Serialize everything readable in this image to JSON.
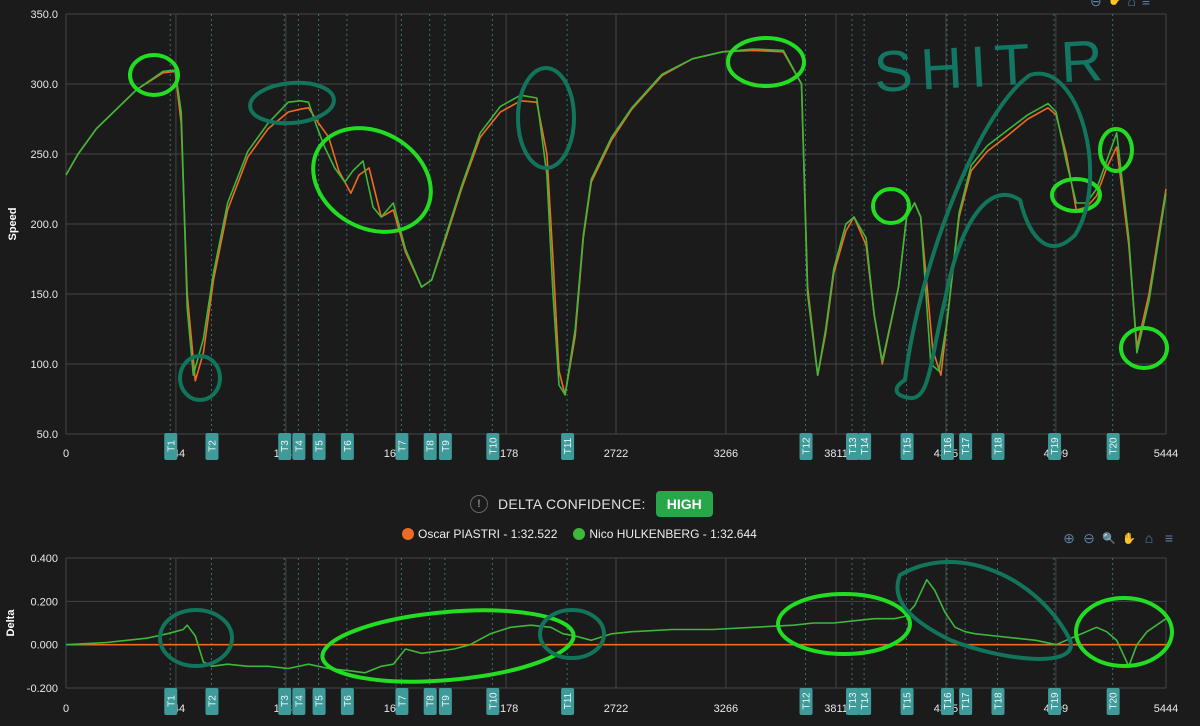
{
  "chart_data": [
    {
      "type": "line",
      "ylabel": "Speed",
      "ylim": [
        50,
        350
      ],
      "yticks": [
        "350.0",
        "300.0",
        "250.0",
        "200.0",
        "150.0",
        "100.0",
        "50.0"
      ],
      "xlim": [
        0,
        5444
      ],
      "xticks": [
        "0",
        "544",
        "1088",
        "1633",
        "2178",
        "2722",
        "3266",
        "3811",
        "4355",
        "4899",
        "5444"
      ],
      "series": [
        {
          "name": "Oscar PIASTRI",
          "color": "#ef6a22",
          "x": [
            0,
            60,
            150,
            250,
            350,
            480,
            540,
            570,
            600,
            640,
            680,
            730,
            800,
            900,
            1000,
            1100,
            1160,
            1200,
            1250,
            1300,
            1350,
            1410,
            1450,
            1500,
            1560,
            1620,
            1680,
            1760,
            1810,
            1880,
            1960,
            2050,
            2150,
            2250,
            2330,
            2380,
            2410,
            2440,
            2470,
            2520,
            2560,
            2600,
            2700,
            2800,
            2950,
            3100,
            3250,
            3400,
            3550,
            3640,
            3670,
            3720,
            3760,
            3800,
            3860,
            3900,
            3960,
            4000,
            4040,
            4120,
            4160,
            4200,
            4230,
            4290,
            4330,
            4360,
            4420,
            4480,
            4560,
            4650,
            4760,
            4860,
            4900,
            4950,
            5000,
            5050,
            5100,
            5150,
            5200,
            5260,
            5300,
            5360,
            5444
          ],
          "y": [
            235,
            250,
            268,
            282,
            296,
            308,
            309,
            272,
            150,
            88,
            108,
            160,
            210,
            248,
            268,
            280,
            282,
            283,
            272,
            262,
            238,
            222,
            235,
            240,
            205,
            210,
            180,
            155,
            160,
            190,
            226,
            262,
            280,
            288,
            287,
            250,
            175,
            95,
            78,
            120,
            190,
            230,
            260,
            282,
            306,
            318,
            323,
            324,
            323,
            300,
            155,
            92,
            122,
            165,
            195,
            205,
            185,
            135,
            100,
            155,
            205,
            215,
            205,
            110,
            92,
            130,
            205,
            238,
            252,
            262,
            275,
            283,
            278,
            250,
            210,
            212,
            220,
            240,
            255,
            185,
            112,
            150,
            225
          ]
        },
        {
          "name": "Nico HULKENBERG",
          "color": "#3db83a",
          "x": [
            0,
            60,
            150,
            250,
            350,
            480,
            540,
            570,
            600,
            630,
            680,
            730,
            800,
            900,
            1000,
            1100,
            1160,
            1200,
            1240,
            1280,
            1330,
            1380,
            1420,
            1470,
            1520,
            1560,
            1620,
            1680,
            1760,
            1810,
            1880,
            1960,
            2050,
            2150,
            2250,
            2330,
            2380,
            2410,
            2440,
            2470,
            2520,
            2560,
            2600,
            2700,
            2800,
            2950,
            3100,
            3250,
            3400,
            3550,
            3640,
            3670,
            3720,
            3760,
            3800,
            3860,
            3900,
            3960,
            4000,
            4040,
            4120,
            4160,
            4200,
            4230,
            4280,
            4320,
            4360,
            4420,
            4480,
            4560,
            4650,
            4760,
            4860,
            4900,
            4950,
            5000,
            5050,
            5100,
            5150,
            5200,
            5260,
            5300,
            5360,
            5444
          ],
          "y": [
            235,
            250,
            268,
            282,
            296,
            309,
            310,
            280,
            140,
            92,
            118,
            165,
            215,
            252,
            272,
            287,
            288,
            287,
            270,
            255,
            240,
            230,
            238,
            245,
            212,
            205,
            215,
            182,
            155,
            160,
            192,
            228,
            265,
            284,
            292,
            290,
            235,
            150,
            85,
            78,
            125,
            192,
            232,
            262,
            283,
            307,
            318,
            323,
            325,
            324,
            300,
            150,
            92,
            125,
            168,
            200,
            205,
            190,
            135,
            102,
            155,
            205,
            215,
            205,
            100,
            95,
            130,
            208,
            242,
            256,
            266,
            278,
            286,
            280,
            245,
            215,
            215,
            225,
            245,
            265,
            190,
            108,
            145,
            222
          ]
        }
      ]
    },
    {
      "type": "line",
      "ylabel": "Delta",
      "ylim": [
        -0.2,
        0.4
      ],
      "yticks": [
        "0.400",
        "0.200",
        "0.000",
        "-0.200"
      ],
      "xlim": [
        0,
        5444
      ],
      "xticks": [
        "0",
        "544",
        "1088",
        "1633",
        "2178",
        "2722",
        "3266",
        "3811",
        "4355",
        "4899",
        "5444"
      ],
      "series": [
        {
          "name": "Oscar PIASTRI",
          "color": "#ef6a22",
          "x": [
            0,
            5444
          ],
          "y": [
            0,
            0
          ]
        },
        {
          "name": "Nico HULKENBERG",
          "color": "#3db83a",
          "x": [
            0,
            200,
            400,
            500,
            540,
            580,
            600,
            640,
            680,
            720,
            800,
            900,
            1000,
            1100,
            1200,
            1300,
            1400,
            1480,
            1560,
            1620,
            1680,
            1760,
            1840,
            1920,
            2000,
            2100,
            2200,
            2300,
            2400,
            2460,
            2520,
            2600,
            2700,
            2800,
            3000,
            3200,
            3400,
            3600,
            3700,
            3800,
            3900,
            4000,
            4100,
            4150,
            4200,
            4260,
            4300,
            4350,
            4400,
            4450,
            4500,
            4600,
            4700,
            4800,
            4900,
            4950,
            5000,
            5050,
            5100,
            5150,
            5200,
            5260,
            5300,
            5350,
            5444
          ],
          "y": [
            0,
            0.01,
            0.03,
            0.05,
            0.06,
            0.07,
            0.09,
            0.04,
            -0.08,
            -0.1,
            -0.09,
            -0.1,
            -0.1,
            -0.11,
            -0.09,
            -0.11,
            -0.12,
            -0.13,
            -0.1,
            -0.09,
            -0.02,
            -0.04,
            -0.03,
            -0.02,
            0.0,
            0.05,
            0.08,
            0.09,
            0.08,
            0.05,
            0.04,
            0.02,
            0.05,
            0.06,
            0.07,
            0.07,
            0.08,
            0.09,
            0.1,
            0.1,
            0.11,
            0.12,
            0.12,
            0.13,
            0.18,
            0.3,
            0.25,
            0.15,
            0.08,
            0.06,
            0.05,
            0.04,
            0.03,
            0.02,
            0.0,
            0.02,
            0.04,
            0.06,
            0.08,
            0.06,
            0.02,
            -0.1,
            0.0,
            0.06,
            0.12
          ]
        }
      ]
    }
  ],
  "turns": [
    {
      "label": "T1",
      "x": 516
    },
    {
      "label": "T2",
      "x": 720
    },
    {
      "label": "T3",
      "x": 1080
    },
    {
      "label": "T4",
      "x": 1150
    },
    {
      "label": "T5",
      "x": 1250
    },
    {
      "label": "T6",
      "x": 1390
    },
    {
      "label": "T7",
      "x": 1660
    },
    {
      "label": "T8",
      "x": 1800
    },
    {
      "label": "T9",
      "x": 1875
    },
    {
      "label": "T10",
      "x": 2110
    },
    {
      "label": "T11",
      "x": 2480
    },
    {
      "label": "T12",
      "x": 3660
    },
    {
      "label": "T13",
      "x": 3890
    },
    {
      "label": "T14",
      "x": 3950
    },
    {
      "label": "T15",
      "x": 4160
    },
    {
      "label": "T16",
      "x": 4360
    },
    {
      "label": "T17",
      "x": 4450
    },
    {
      "label": "T18",
      "x": 4610
    },
    {
      "label": "T19",
      "x": 4890
    },
    {
      "label": "T20",
      "x": 5180
    }
  ],
  "confidence": {
    "label": "DELTA CONFIDENCE:",
    "value": "HIGH",
    "info": "!"
  },
  "legend": [
    {
      "label": "Oscar PIASTRI - 1:32.522",
      "color": "#ef6a22"
    },
    {
      "label": "Nico HULKENBERG - 1:32.644",
      "color": "#3db83a"
    }
  ],
  "toolbar": {
    "zoom_in": "⊕",
    "zoom_out": "⊖",
    "zoom": "🔍",
    "pan": "✋",
    "home": "⌂",
    "menu": "≡"
  },
  "annotation_text": "SHIT R"
}
